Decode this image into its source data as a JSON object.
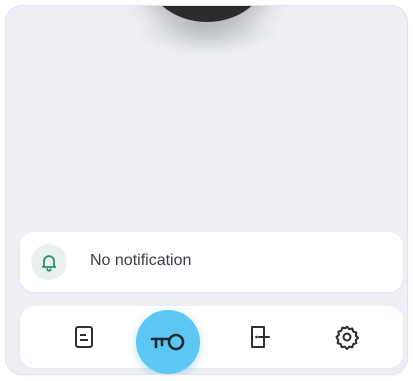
{
  "notification": {
    "icon": "bell-icon",
    "text": "No notification",
    "accent_color": "#2f8f75"
  },
  "nav": {
    "items": [
      {
        "name": "document",
        "icon": "document-icon"
      },
      {
        "name": "key",
        "icon": "key-icon",
        "active": true
      },
      {
        "name": "door",
        "icon": "door-icon"
      },
      {
        "name": "settings",
        "icon": "gear-icon"
      }
    ],
    "active_color": "#5cc7f2",
    "icon_color": "#2e2f33"
  }
}
